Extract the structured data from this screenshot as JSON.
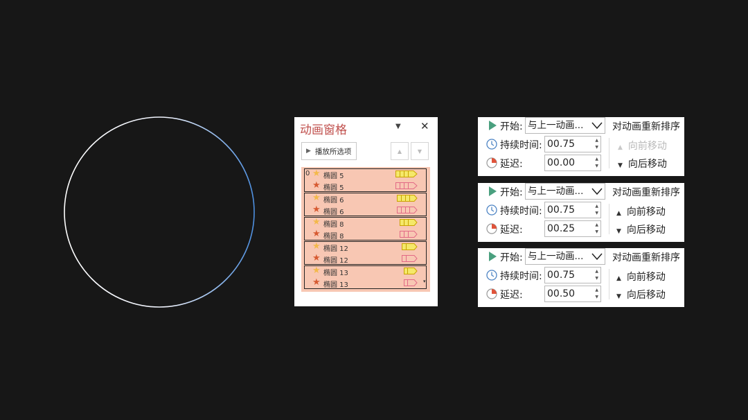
{
  "pane": {
    "title": "动画窗格",
    "dropdown_icon": "caret-down-icon",
    "close_icon": "close-icon",
    "play_button": "播放所选项",
    "move_up_icon": "up-triangle-icon",
    "move_down_icon": "down-triangle-icon",
    "order_number": "0",
    "rows": [
      {
        "label": "椭圆 5",
        "star": "light"
      },
      {
        "label": "椭圆 5",
        "star": "dark"
      },
      {
        "label": "椭圆 6",
        "star": "light"
      },
      {
        "label": "椭圆 6",
        "star": "dark"
      },
      {
        "label": "椭圆 8",
        "star": "light"
      },
      {
        "label": "椭圆 8",
        "star": "dark"
      },
      {
        "label": "椭圆 12",
        "star": "light"
      },
      {
        "label": "椭圆 12",
        "star": "dark"
      },
      {
        "label": "椭圆 13",
        "star": "light"
      },
      {
        "label": "椭圆 13",
        "star": "dark"
      }
    ]
  },
  "timing_panels": [
    {
      "start_label": "开始:",
      "start_value": "与上一动画...",
      "duration_label": "持续时间:",
      "duration_value": "00.75",
      "delay_label": "延迟:",
      "delay_value": "00.00",
      "reorder_title": "对动画重新排序",
      "move_earlier": "向前移动",
      "move_later": "向后移动",
      "move_earlier_disabled": true
    },
    {
      "start_label": "开始:",
      "start_value": "与上一动画...",
      "duration_label": "持续时间:",
      "duration_value": "00.75",
      "delay_label": "延迟:",
      "delay_value": "00.25",
      "reorder_title": "对动画重新排序",
      "move_earlier": "向前移动",
      "move_later": "向后移动",
      "move_earlier_disabled": false
    },
    {
      "start_label": "开始:",
      "start_value": "与上一动画...",
      "duration_label": "持续时间:",
      "duration_value": "00.75",
      "delay_label": "延迟:",
      "delay_value": "00.50",
      "reorder_title": "对动画重新排序",
      "move_earlier": "向前移动",
      "move_later": "向后移动",
      "move_earlier_disabled": false
    }
  ],
  "colors": {
    "background": "#171717",
    "pane_title": "#c0504d",
    "list_bg": "#f8c7b3",
    "star_light": "#f3b94a",
    "star_dark": "#d65a31",
    "bar_light": "#f5e86a",
    "bar_pink": "#f2a0b3",
    "play_green": "#4aa07f"
  }
}
